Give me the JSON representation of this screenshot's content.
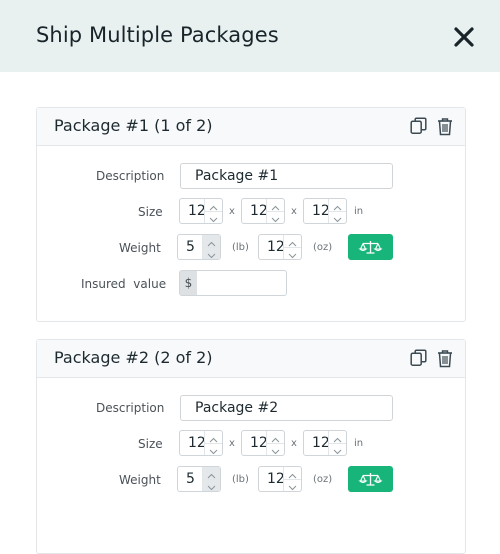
{
  "dialog": {
    "title": "Ship Multiple Packages",
    "close_icon": "close-icon"
  },
  "labels": {
    "description": "Description",
    "size": "Size",
    "weight": "Weight",
    "insured_value": "Insured  value",
    "times": "x",
    "in": "in",
    "lb": "(lb)",
    "oz": "(oz)",
    "currency": "$"
  },
  "packages": [
    {
      "title": "Package #1 (1 of 2)",
      "description": "Package #1",
      "length": "12",
      "width": "12",
      "height": "12",
      "weight_lb": "5",
      "weight_oz": "12",
      "insured_value": ""
    },
    {
      "title": "Package #2 (2 of 2)",
      "description": "Package #2",
      "length": "12",
      "width": "12",
      "height": "12",
      "weight_lb": "5",
      "weight_oz": "12"
    }
  ],
  "colors": {
    "header_bg": "#e8f1ef",
    "accent": "#17b57a",
    "border": "#cfd5d9"
  }
}
